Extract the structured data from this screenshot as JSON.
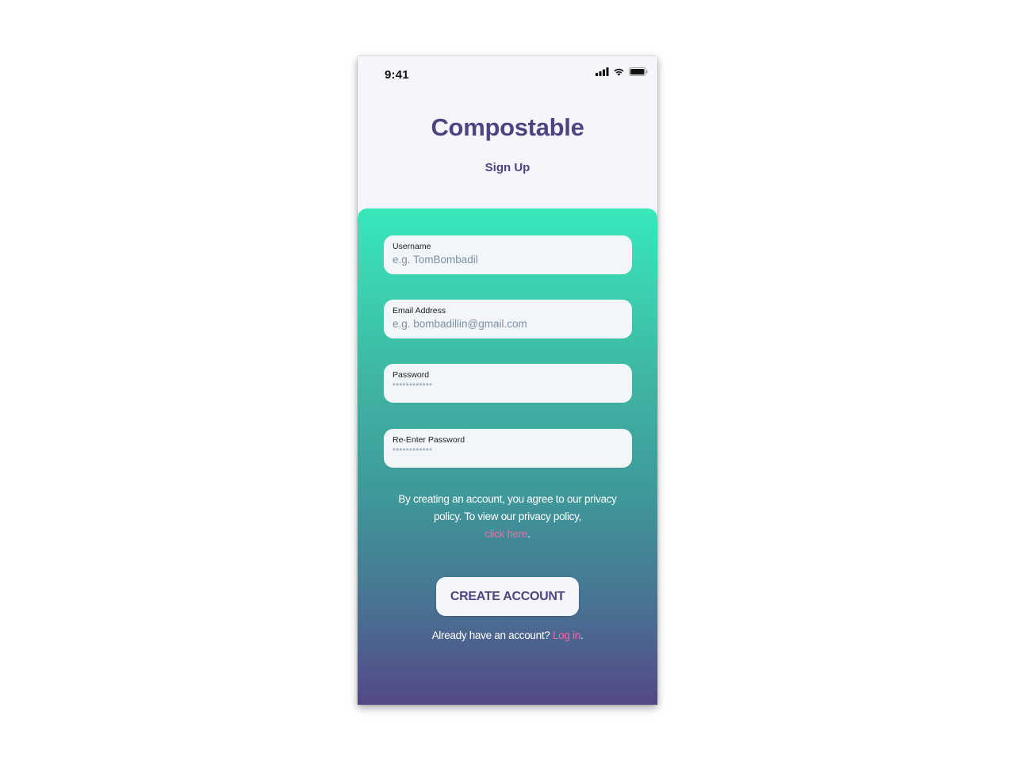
{
  "status_bar": {
    "time": "9:41",
    "icons": [
      "signal-icon",
      "wifi-icon",
      "battery-icon"
    ]
  },
  "header": {
    "app_title": "Compostable",
    "subtitle": "Sign Up"
  },
  "form": {
    "fields": [
      {
        "label": "Username",
        "placeholder": "e.g. TomBombadil"
      },
      {
        "label": "Email Address",
        "placeholder": "e.g. bombadillin@gmail.com"
      },
      {
        "label": "Password",
        "placeholder": "************"
      },
      {
        "label": "Re-Enter Password",
        "placeholder": "************"
      }
    ]
  },
  "policy": {
    "text": "By creating an account, you agree to our privacy policy. To view our privacy policy,",
    "link_text": "click here",
    "suffix": "."
  },
  "actions": {
    "create_button": "CREATE ACCOUNT",
    "login_prompt": "Already have an account?",
    "login_link": "Log in",
    "login_suffix": "."
  },
  "colors": {
    "brand_purple": "#4f4480",
    "gradient_top": "#38e8bb",
    "gradient_bottom": "#534985",
    "link_pink": "#ec6aa6",
    "field_bg": "#f2f6f9"
  }
}
